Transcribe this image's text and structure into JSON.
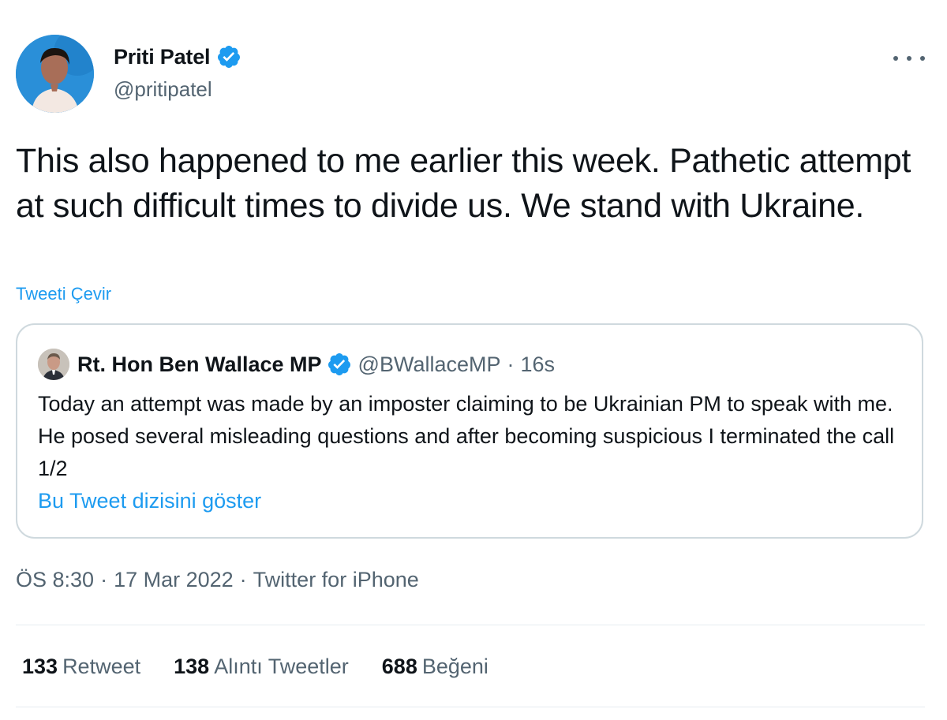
{
  "author": {
    "name": "Priti Patel",
    "handle": "@pritipatel",
    "verified": true
  },
  "tweet": {
    "text": "This also happened to me earlier this week. Pathetic attempt at such difficult times to divide us. We stand with Ukraine.",
    "translate_label": "Tweeti Çevir"
  },
  "quoted_tweet": {
    "name": "Rt. Hon Ben Wallace MP",
    "handle": "@BWallaceMP",
    "separator": "·",
    "time": "16s",
    "verified": true,
    "text": "Today an attempt was made by an imposter claiming to be Ukrainian PM to speak with me. He posed several misleading questions and after becoming suspicious I terminated the call 1/2",
    "thread_link_label": "Bu Tweet dizisini göster"
  },
  "meta": {
    "time": "ÖS 8:30",
    "separator": "·",
    "date": "17 Mar 2022",
    "source": "Twitter for iPhone"
  },
  "stats": [
    {
      "count": "133",
      "label": "Retweet"
    },
    {
      "count": "138",
      "label": "Alıntı Tweetler"
    },
    {
      "count": "688",
      "label": "Beğeni"
    }
  ],
  "icons": {
    "more": "more-horizontal-icon",
    "verified": "verified-badge-icon"
  },
  "colors": {
    "accent": "#1d9bf0",
    "text_primary": "#0f1419",
    "text_secondary": "#536471",
    "border": "#cfd9de"
  }
}
